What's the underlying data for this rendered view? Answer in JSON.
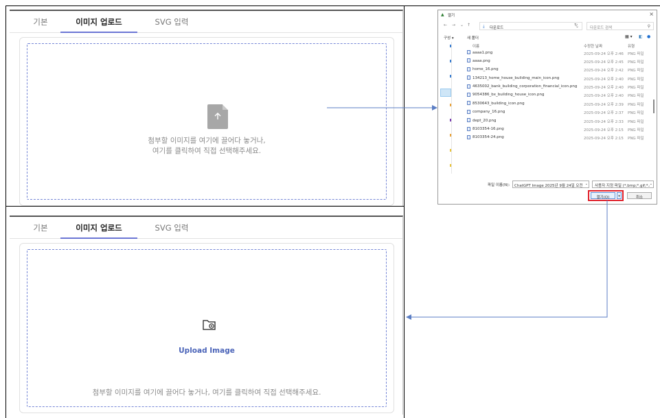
{
  "colors": {
    "accent": "#6a75d4",
    "dashed_border": "#7586d6",
    "upload_link": "#4a63b8",
    "arrow": "#5b7ec4",
    "highlight": "#e0202a"
  },
  "top_panel": {
    "tabs": [
      {
        "label": "기본",
        "active": false
      },
      {
        "label": "이미지 업로드",
        "active": true
      },
      {
        "label": "SVG 입력",
        "active": false
      }
    ],
    "dropzone": {
      "icon": "file-upload-icon",
      "line1": "첨부할 이미지를 여기에 끌어다 놓거나,",
      "line2": "여기를 클릭하여 직접 선택해주세요."
    }
  },
  "bottom_panel": {
    "tabs": [
      {
        "label": "기본",
        "active": false
      },
      {
        "label": "이미지 업로드",
        "active": true
      },
      {
        "label": "SVG 입력",
        "active": false
      }
    ],
    "dropzone": {
      "icon": "folder-image-icon",
      "upload_label": "Upload Image",
      "hint": "첨부할 이미지를 여기에 끌어다 놓거나, 여기를 클릭하여 직접 선택해주세요."
    }
  },
  "dialog": {
    "title": "열기",
    "address": "다운로드",
    "search_placeholder": "다운로드 검색",
    "organize": "구성 ▾",
    "new_folder": "새 폴더",
    "columns": {
      "name": "이름",
      "date": "수정한 날짜",
      "type": "유형"
    },
    "files": [
      {
        "name": "aaaa1.png",
        "date": "2025-09-24 오후 2:46",
        "type": "PNG 파일"
      },
      {
        "name": "aaaa.png",
        "date": "2025-09-24 오후 2:45",
        "type": "PNG 파일"
      },
      {
        "name": "home_16.png",
        "date": "2025-09-24 오후 2:42",
        "type": "PNG 파일"
      },
      {
        "name": "134213_home_house_building_main_icon.png",
        "date": "2025-09-24 오후 2:40",
        "type": "PNG 파일"
      },
      {
        "name": "4635002_bank_building_corporation_financial_icon.png",
        "date": "2025-09-24 오후 2:40",
        "type": "PNG 파일"
      },
      {
        "name": "9054386_bx_building_house_icon.png",
        "date": "2025-09-24 오후 2:40",
        "type": "PNG 파일"
      },
      {
        "name": "8530643_building_icon.png",
        "date": "2025-09-24 오후 2:39",
        "type": "PNG 파일"
      },
      {
        "name": "company_16.png",
        "date": "2025-09-24 오후 2:37",
        "type": "PNG 파일"
      },
      {
        "name": "dept_20.png",
        "date": "2025-09-24 오후 2:33",
        "type": "PNG 파일"
      },
      {
        "name": "8103354-16.png",
        "date": "2025-09-24 오후 2:15",
        "type": "PNG 파일"
      },
      {
        "name": "8103354-24.png",
        "date": "2025-09-24 오후 2:15",
        "type": "PNG 파일"
      }
    ],
    "filename_label": "파일 이름(N):",
    "filename_value": "ChatGPT Image 2025년 9월 24일 오전",
    "filetype_value": "사용자 지정 파일 (*.bmp;*.gif;*.a",
    "open_button": "열기(O)",
    "cancel_button": "취소"
  }
}
